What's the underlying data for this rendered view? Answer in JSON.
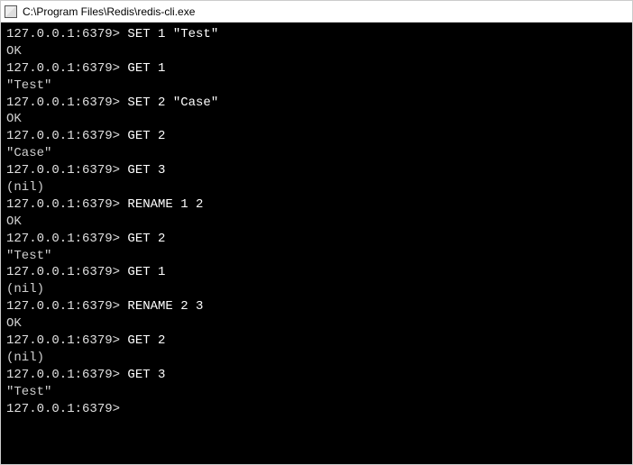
{
  "window": {
    "title": "C:\\Program Files\\Redis\\redis-cli.exe"
  },
  "terminal": {
    "prompt": "127.0.0.1:6379>",
    "lines": [
      {
        "type": "cmd",
        "text": "SET 1 \"Test\""
      },
      {
        "type": "out",
        "text": "OK"
      },
      {
        "type": "cmd",
        "text": "GET 1"
      },
      {
        "type": "out",
        "text": "\"Test\""
      },
      {
        "type": "cmd",
        "text": "SET 2 \"Case\""
      },
      {
        "type": "out",
        "text": "OK"
      },
      {
        "type": "cmd",
        "text": "GET 2"
      },
      {
        "type": "out",
        "text": "\"Case\""
      },
      {
        "type": "cmd",
        "text": "GET 3"
      },
      {
        "type": "out",
        "text": "(nil)"
      },
      {
        "type": "cmd",
        "text": "RENAME 1 2"
      },
      {
        "type": "out",
        "text": "OK"
      },
      {
        "type": "cmd",
        "text": "GET 2"
      },
      {
        "type": "out",
        "text": "\"Test\""
      },
      {
        "type": "cmd",
        "text": "GET 1"
      },
      {
        "type": "out",
        "text": "(nil)"
      },
      {
        "type": "cmd",
        "text": "RENAME 2 3"
      },
      {
        "type": "out",
        "text": "OK"
      },
      {
        "type": "cmd",
        "text": "GET 2"
      },
      {
        "type": "out",
        "text": "(nil)"
      },
      {
        "type": "cmd",
        "text": "GET 3"
      },
      {
        "type": "out",
        "text": "\"Test\""
      },
      {
        "type": "cmd",
        "text": ""
      }
    ]
  }
}
